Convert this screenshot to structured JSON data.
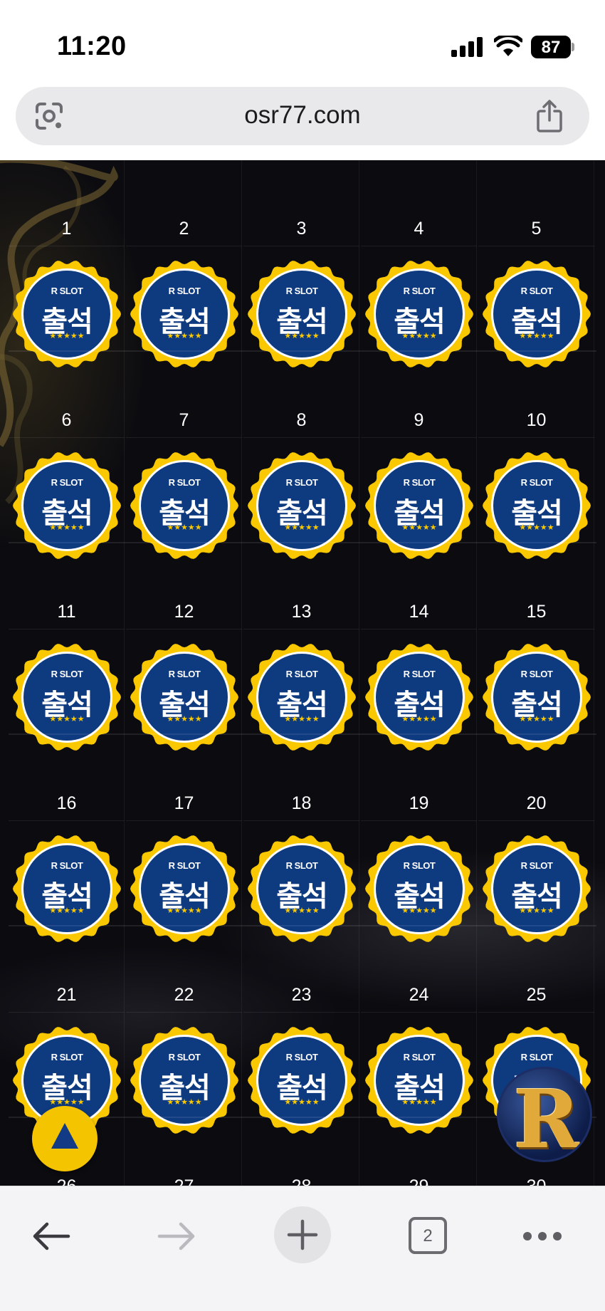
{
  "status_bar": {
    "time": "11:20",
    "battery": "87"
  },
  "browser": {
    "url": "osr77.com",
    "tab_count": "2"
  },
  "attendance": {
    "badge_brand": "R SLOT",
    "badge_main": "출석",
    "badge_stars": "★★★★★",
    "days": [
      [
        "1",
        "2",
        "3",
        "4",
        "5"
      ],
      [
        "6",
        "7",
        "8",
        "9",
        "10"
      ],
      [
        "11",
        "12",
        "13",
        "14",
        "15"
      ],
      [
        "16",
        "17",
        "18",
        "19",
        "20"
      ],
      [
        "21",
        "22",
        "23",
        "24",
        "25"
      ],
      [
        "26",
        "27",
        "28",
        "29",
        "30"
      ]
    ]
  },
  "floating": {
    "logo_letter": "R"
  },
  "colors": {
    "badge_gold": "#f9c800",
    "badge_blue": "#0e3a80",
    "page_bg": "#0b0b10",
    "scroll_top_bg": "#f5c400"
  },
  "icons": {
    "lens": "google-lens-icon",
    "share": "share-icon",
    "scroll_top": "triangle-up-icon",
    "back": "arrow-left-icon",
    "forward": "arrow-right-icon",
    "new_tab": "plus-icon",
    "more": "ellipsis-icon"
  }
}
